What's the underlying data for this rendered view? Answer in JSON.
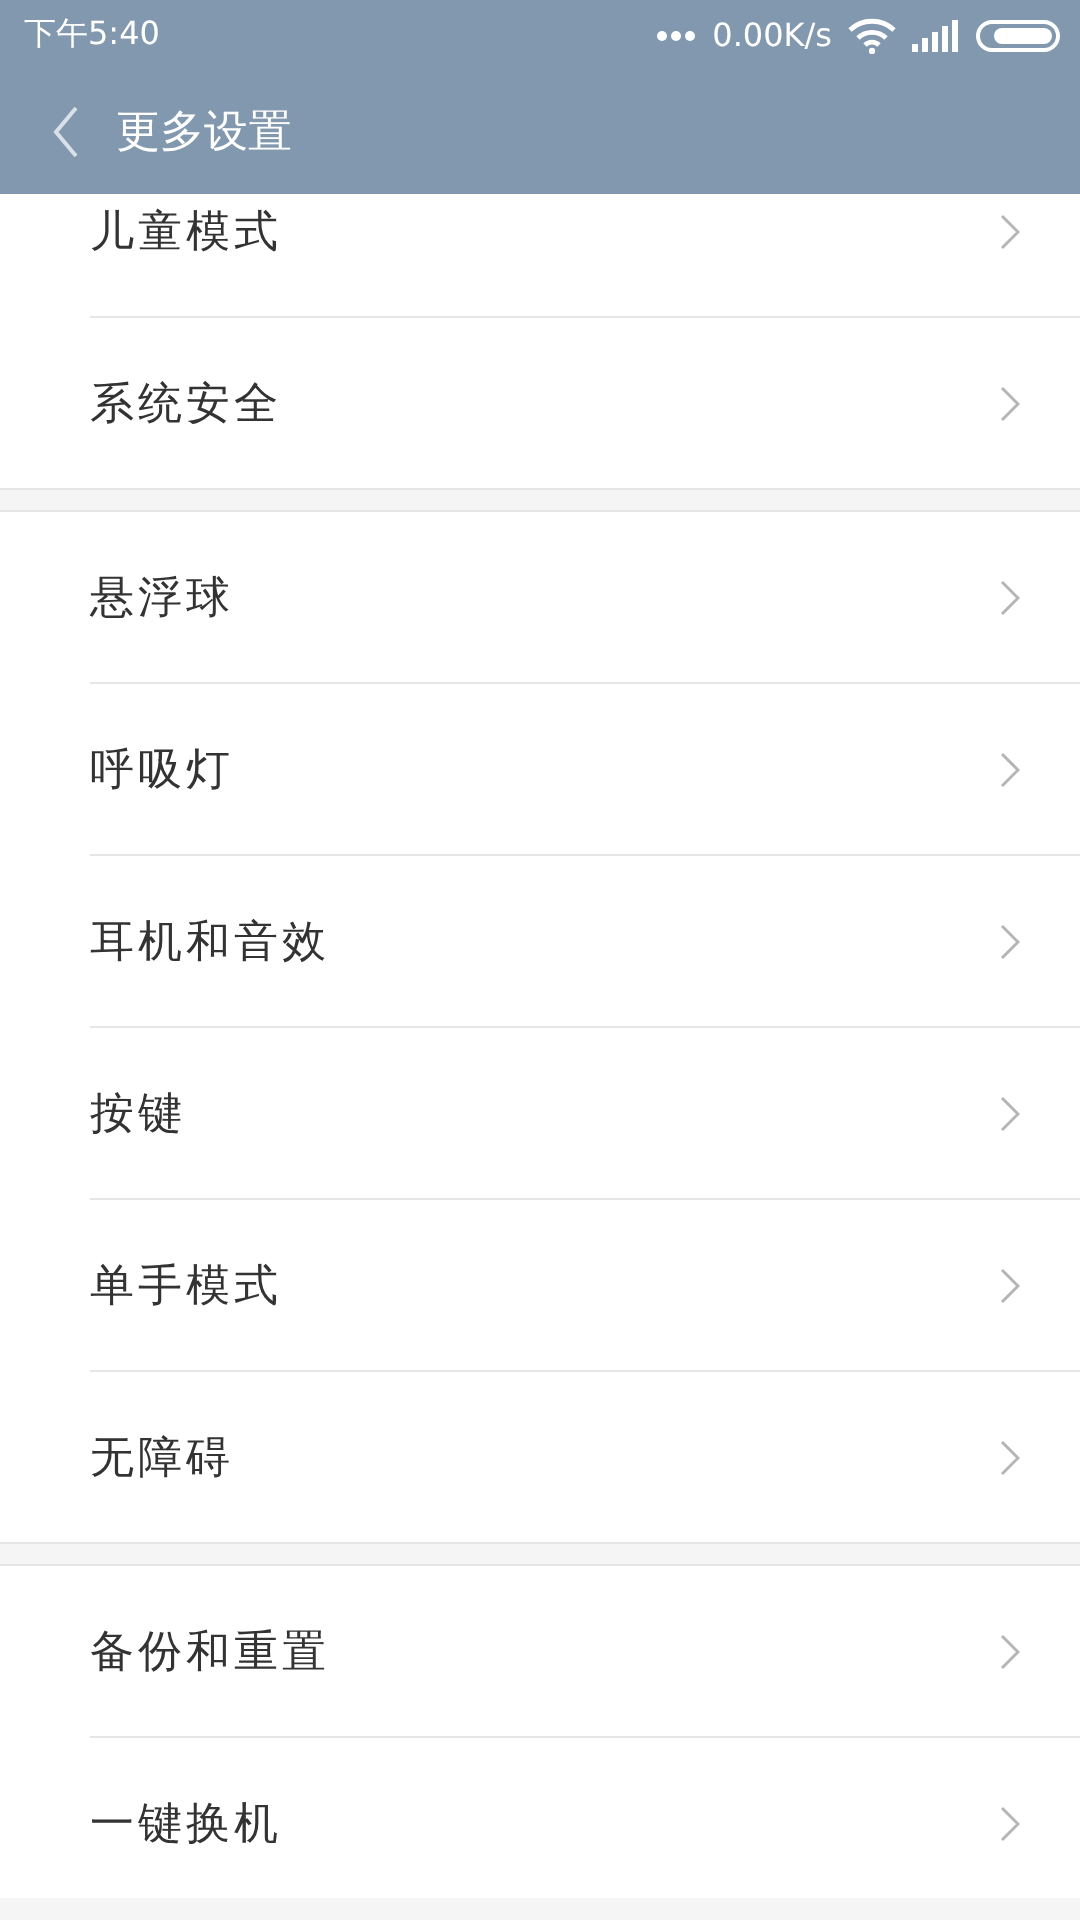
{
  "status_bar": {
    "time": "下午5:40",
    "speed": "0.00K/s"
  },
  "header": {
    "title": "更多设置"
  },
  "sections": [
    {
      "items": [
        {
          "label": "儿童模式"
        },
        {
          "label": "系统安全"
        }
      ]
    },
    {
      "items": [
        {
          "label": "悬浮球"
        },
        {
          "label": "呼吸灯"
        },
        {
          "label": "耳机和音效"
        },
        {
          "label": "按键"
        },
        {
          "label": "单手模式"
        },
        {
          "label": "无障碍"
        }
      ]
    },
    {
      "items": [
        {
          "label": "备份和重置"
        },
        {
          "label": "一键换机"
        }
      ]
    }
  ]
}
